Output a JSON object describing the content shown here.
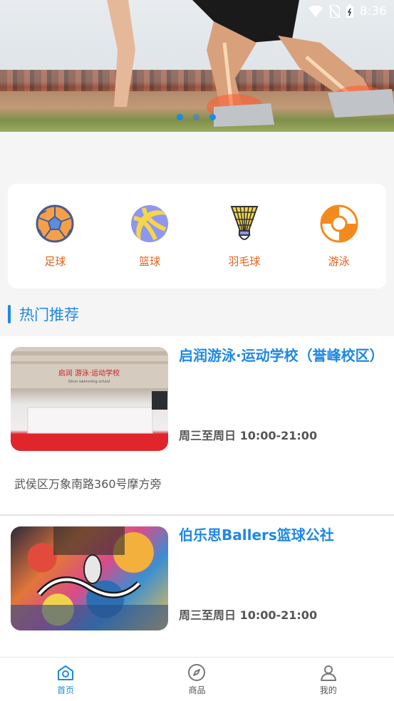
{
  "status_bar": {
    "time": "8:36"
  },
  "banner": {
    "slides": 3,
    "active_slide": 1
  },
  "categories": [
    {
      "label": "足球",
      "icon": "soccer-ball-icon"
    },
    {
      "label": "篮球",
      "icon": "basketball-icon"
    },
    {
      "label": "羽毛球",
      "icon": "shuttlecock-icon"
    },
    {
      "label": "游泳",
      "icon": "lifebuoy-icon"
    }
  ],
  "section": {
    "title": "热门推荐"
  },
  "venues": [
    {
      "name": "启润游泳·运动学校（誉峰校区）",
      "hours": "周三至周日 10:00-21:00",
      "address": "武侯区万象南路360号摩方旁",
      "thumb_sign": "启润 游泳·运动学校",
      "thumb_sign_en": "Qirun swimming school"
    },
    {
      "name": "伯乐思Ballers篮球公社",
      "hours": "周三至周日 10:00-21:00"
    }
  ],
  "nav": [
    {
      "label": "首页",
      "icon": "home-icon",
      "active": true
    },
    {
      "label": "商品",
      "icon": "compass-icon",
      "active": false
    },
    {
      "label": "我的",
      "icon": "user-icon",
      "active": false
    }
  ],
  "colors": {
    "accent": "#1e88e5",
    "category_label": "#e0621b"
  }
}
